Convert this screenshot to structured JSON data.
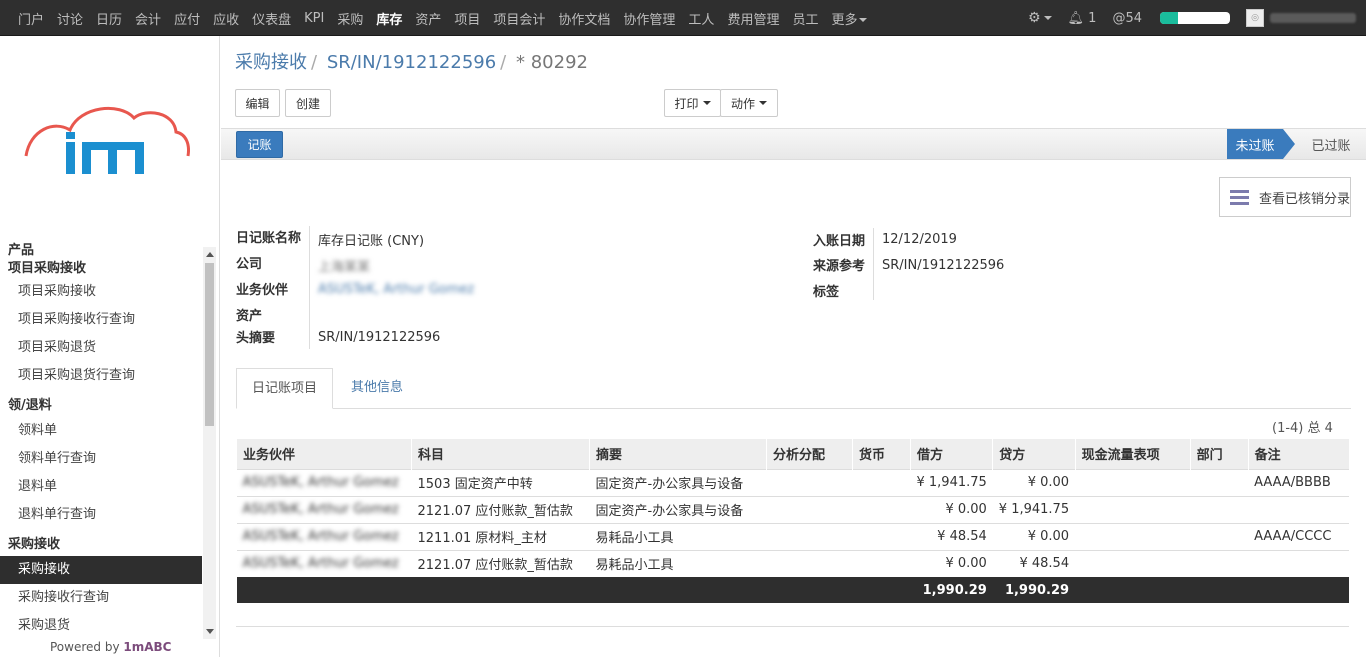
{
  "nav": {
    "items": [
      "门户",
      "讨论",
      "日历",
      "会计",
      "应付",
      "应收",
      "仪表盘",
      "KPI",
      "采购",
      "库存",
      "资产",
      "项目",
      "项目会计",
      "协作文档",
      "协作管理",
      "工人",
      "费用管理",
      "员工"
    ],
    "more": "更多",
    "active": "库存",
    "messages": "1",
    "activity": "54"
  },
  "sidebar": {
    "sections": [
      {
        "title": "产品",
        "items": []
      },
      {
        "title": "项目采购接收",
        "items": [
          "项目采购接收",
          "项目采购接收行查询",
          "项目采购退货",
          "项目采购退货行查询"
        ]
      },
      {
        "title": "领/退料",
        "items": [
          "领料单",
          "领料单行查询",
          "退料单",
          "退料单行查询"
        ]
      },
      {
        "title": "采购接收",
        "items": [
          "采购接收",
          "采购接收行查询",
          "采购退货"
        ]
      }
    ],
    "active_item": "采购接收",
    "powered_prefix": "Powered by",
    "powered_brand": "1mABC"
  },
  "breadcrumb": {
    "root": "采购接收",
    "ref": "SR/IN/1912122596",
    "current": "* 80292"
  },
  "buttons": {
    "edit": "编辑",
    "create": "创建",
    "print": "打印",
    "action": "动作",
    "post": "记账"
  },
  "status": {
    "current": "未过账",
    "next": "已过账"
  },
  "smart_button": "查看已核销分录",
  "form": {
    "journal_label": "日记账名称",
    "journal": "库存日记账 (CNY)",
    "company_label": "公司",
    "company": "上海某某",
    "partner_label": "业务伙伴",
    "partner": "ASUSTeK, Arthur Gomez",
    "asset_label": "资产",
    "asset": "",
    "memo_label": "头摘要",
    "memo": "SR/IN/1912122596",
    "date_label": "入账日期",
    "date": "12/12/2019",
    "source_label": "来源参考",
    "source": "SR/IN/1912122596",
    "tags_label": "标签",
    "tags": ""
  },
  "tabs": {
    "lines": "日记账项目",
    "other": "其他信息"
  },
  "pager": "(1-4) 总 4",
  "table": {
    "headers": [
      "业务伙伴",
      "科目",
      "摘要",
      "分析分配",
      "货币",
      "借方",
      "贷方",
      "现金流量表项",
      "部门",
      "备注"
    ],
    "rows": [
      [
        "ASUSTeK, Arthur Gomez",
        "1503 固定资产中转",
        "固定资产-办公家具与设备",
        "",
        "",
        "¥ 1,941.75",
        "¥ 0.00",
        "",
        "",
        "AAAA/BBBB"
      ],
      [
        "ASUSTeK, Arthur Gomez",
        "2121.07 应付账款_暂估款",
        "固定资产-办公家具与设备",
        "",
        "",
        "¥ 0.00",
        "¥ 1,941.75",
        "",
        "",
        ""
      ],
      [
        "ASUSTeK, Arthur Gomez",
        "1211.01 原材料_主材",
        "易耗品小工具",
        "",
        "",
        "¥ 48.54",
        "¥ 0.00",
        "",
        "",
        "AAAA/CCCC"
      ],
      [
        "ASUSTeK, Arthur Gomez",
        "2121.07 应付账款_暂估款",
        "易耗品小工具",
        "",
        "",
        "¥ 0.00",
        "¥ 48.54",
        "",
        "",
        ""
      ]
    ],
    "totals": {
      "debit": "1,990.29",
      "credit": "1,990.29"
    }
  },
  "colors": {
    "accent": "#3a7bbd",
    "topbar": "#2f2f2f",
    "link": "#4b7bab",
    "brand": "#7c4c7c"
  }
}
